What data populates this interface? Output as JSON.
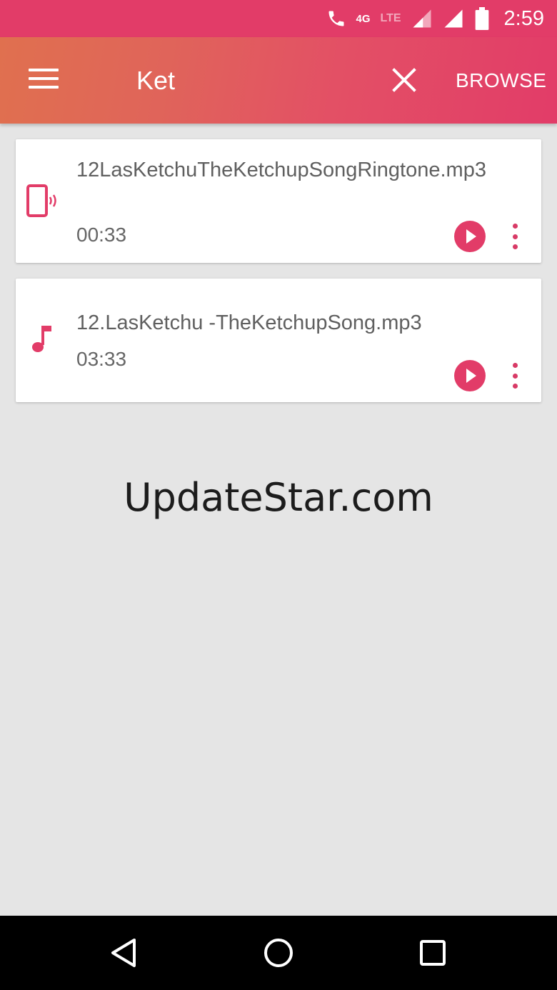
{
  "status_bar": {
    "time": "2:59",
    "network_label": "4G",
    "lte_label": "LTE",
    "icons": [
      "call-icon",
      "signal-icon",
      "signal-full-icon",
      "battery-icon"
    ]
  },
  "app_bar": {
    "title": "Ket",
    "browse_label": "BROWSE",
    "accent_color": "#e23c68"
  },
  "results": [
    {
      "icon": "ringtone-icon",
      "file_name": "12LasKetchuTheKetchupSongRingtone.mp3",
      "duration": "00:33"
    },
    {
      "icon": "music-note-icon",
      "file_name": "12.LasKetchu -TheKetchupSong.mp3",
      "duration": "03:33"
    }
  ],
  "watermark": "UpdateStar.com",
  "nav_bar": {
    "icons": [
      "back-icon",
      "home-icon",
      "recent-apps-icon"
    ]
  }
}
